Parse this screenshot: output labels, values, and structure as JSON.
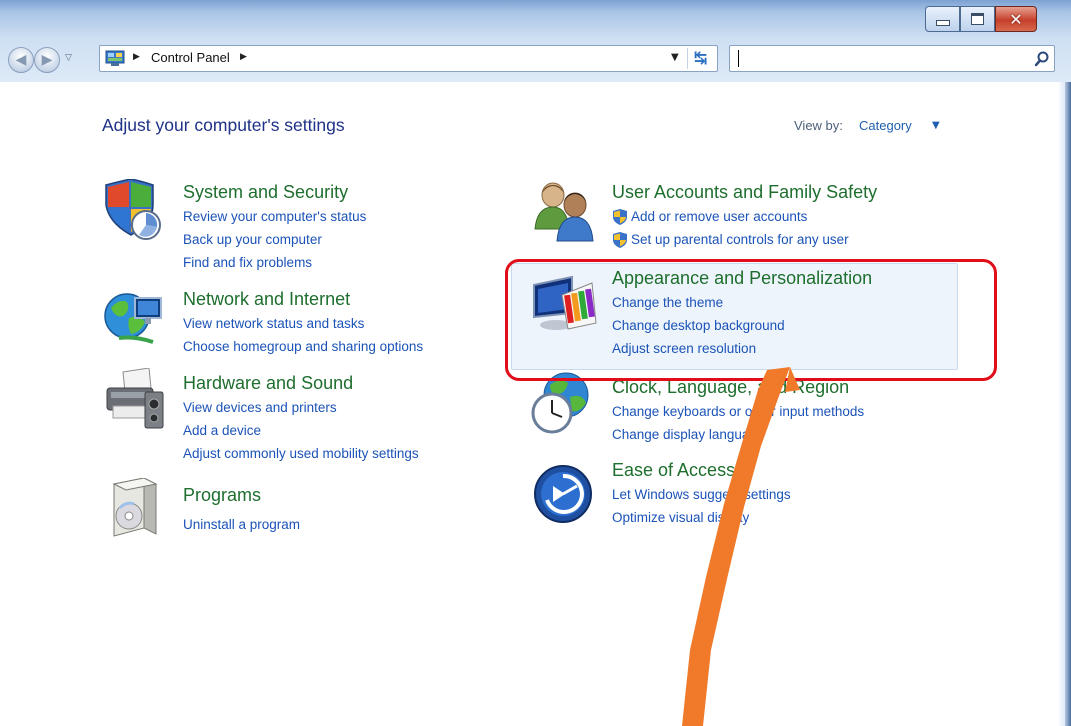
{
  "window": {
    "minimize_label": "",
    "maximize_label": "",
    "close_label": "✕"
  },
  "address": {
    "path": "Control Panel",
    "search_placeholder": ""
  },
  "page": {
    "heading": "Adjust your computer's settings",
    "view_by_label": "View by:",
    "view_by_value": "Category"
  },
  "categories": [
    {
      "title": "System and Security",
      "links": [
        "Review your computer's status",
        "Back up your computer",
        "Find and fix problems"
      ],
      "icon": "shield-icon"
    },
    {
      "title": "Network and Internet",
      "links": [
        "View network status and tasks",
        "Choose homegroup and sharing options"
      ],
      "icon": "network-globe-icon"
    },
    {
      "title": "Hardware and Sound",
      "links": [
        "View devices and printers",
        "Add a device",
        "Adjust commonly used mobility settings"
      ],
      "icon": "printer-icon"
    },
    {
      "title": "Programs",
      "links": [
        "Uninstall a program"
      ],
      "icon": "programs-box-icon"
    },
    {
      "title": "User Accounts and Family Safety",
      "links": [
        "Add or remove user accounts",
        "Set up parental controls for any user"
      ],
      "icon": "users-icon"
    },
    {
      "title": "Appearance and Personalization",
      "links": [
        "Change the theme",
        "Change desktop background",
        "Adjust screen resolution"
      ],
      "icon": "monitor-palette-icon"
    },
    {
      "title": "Clock, Language, and Region",
      "links": [
        "Change keyboards or other input methods",
        "Change display language"
      ],
      "icon": "clock-globe-icon"
    },
    {
      "title": "Ease of Access",
      "links": [
        "Let Windows suggest settings",
        "Optimize visual display"
      ],
      "icon": "ease-of-access-icon"
    }
  ],
  "colors": {
    "title_green": "#1e6e2e",
    "link_blue": "#1b53b8",
    "heading_blue": "#1e3287",
    "annotation_red": "#e10d1a",
    "annotation_orange": "#f07a2a"
  }
}
